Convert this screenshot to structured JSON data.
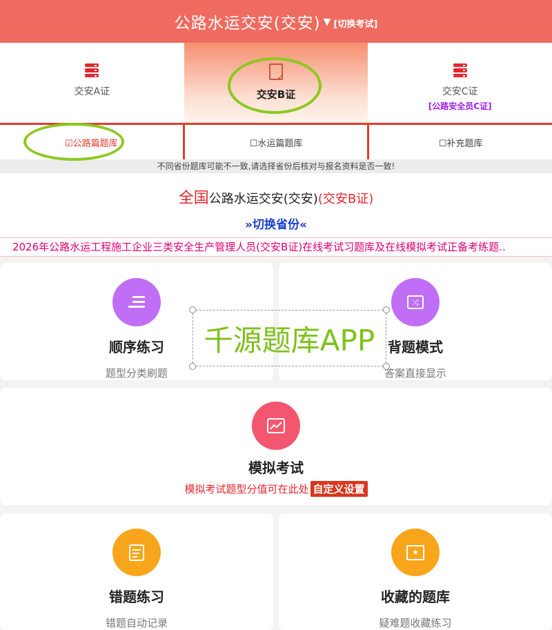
{
  "header": {
    "title": "公路水运交安(交安)",
    "caret": "▼",
    "switch_label": "[切换考试]"
  },
  "certs": [
    {
      "label": "交安A证",
      "icon": "database-icon"
    },
    {
      "label": "交安B证",
      "icon": "document-check-icon",
      "active": true
    },
    {
      "label": "交安C证",
      "sub": "[公路安全员C证]",
      "icon": "database-icon"
    }
  ],
  "banks": [
    {
      "label": "☑公路篇题库",
      "active": true
    },
    {
      "label": "☐水运篇题库"
    },
    {
      "label": "☐补充题库"
    }
  ],
  "notice": "不同省份题库可能不一致,请选择省份后核对与报名资料是否一致!",
  "province": {
    "region": "全国",
    "exam": "公路水运交安(交安)",
    "cert": "(交安B证)",
    "switch": "»切换省份«"
  },
  "marquee": "2026年公路水运工程施工企业三类安全生产管理人员(交安B证)在线考试习题库及在线模拟考试正备考练题..",
  "modes": {
    "sequence": {
      "title": "顺序练习",
      "desc": "题型分类刷题",
      "color": "#c06ef5"
    },
    "recite": {
      "title": "背题模式",
      "desc": "答案直接显示",
      "color": "#c06ef5"
    },
    "mock": {
      "title": "模拟考试",
      "note": "模拟考试题型分值可在此处",
      "button": "自定义设置",
      "color": "#f3566e"
    },
    "wrong": {
      "title": "错题练习",
      "desc": "错题自动记录",
      "color": "#f7a61b"
    },
    "favorites": {
      "title": "收藏的题库",
      "desc": "疑难题收藏练习",
      "color": "#f7a61b"
    }
  },
  "watermark": "千源题库APP"
}
